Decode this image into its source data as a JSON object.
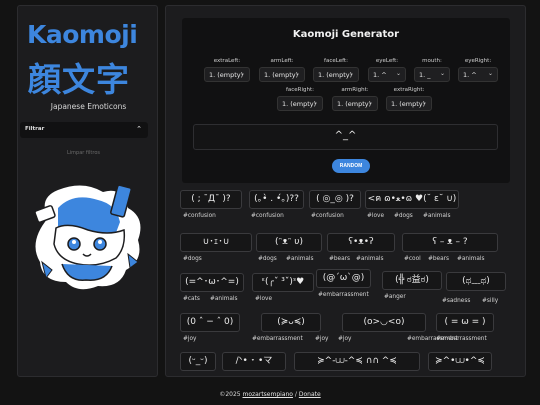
{
  "sidebar": {
    "logo_latin": "Kaomoji",
    "logo_kanji": "顔文字",
    "tagline": "Japanese Emoticons",
    "filter_label": "Filtrar",
    "clear_label": "Limpar filtros"
  },
  "generator": {
    "title": "Kaomoji Generator",
    "selects": [
      {
        "label": "extraLeft:",
        "value": "1. (empty)"
      },
      {
        "label": "armLeft:",
        "value": "1. (empty)"
      },
      {
        "label": "faceLeft:",
        "value": "1. (empty)"
      },
      {
        "label": "eyeLeft:",
        "value": "1. ^"
      },
      {
        "label": "mouth:",
        "value": "1. _"
      },
      {
        "label": "eyeRight:",
        "value": "1. ^"
      },
      {
        "label": "faceRight:",
        "value": "1. (empty)"
      },
      {
        "label": "armRight:",
        "value": "1. (empty)"
      },
      {
        "label": "extraRight:",
        "value": "1. (empty)"
      }
    ],
    "preview": "^_^",
    "random_label": "RANDOM"
  },
  "cards": [
    {
      "text": "( ; ¯Д¯ )?",
      "tags": [
        "#confusion"
      ]
    },
    {
      "text": "(｡•̀ . •́｡)??",
      "tags": [
        "#confusion"
      ]
    },
    {
      "text": "( ◎_◎ )?",
      "tags": [
        "#confusion"
      ]
    },
    {
      "text": "<ฅ ɷ•ﻌ•ɷ ♥(˘ ε˘ ∪)",
      "tags": [
        "#love",
        "#dogs",
        "#animals"
      ]
    },
    {
      "text": "∪･ｪ･∪",
      "tags": [
        "#dogs"
      ]
    },
    {
      "text": "(ᵔᴥᵔ υ)",
      "tags": [
        "#dogs",
        "#animals"
      ]
    },
    {
      "text": "ʕ•ᴥ•ʔ",
      "tags": [
        "#bears",
        "#animals"
      ]
    },
    {
      "text": "ʕ – ᴥ – ?",
      "tags": [
        "#cool",
        "#bears",
        "#animals"
      ]
    },
    {
      "text": "(=^･ω･^=)",
      "tags": [
        "#cats",
        "#animals"
      ]
    },
    {
      "text": "ᵋ(╭ˇ ³ˇ)ᵌ♥",
      "tags": [
        "#love"
      ]
    },
    {
      "text": "(@´ω`@)",
      "tags": [
        "#embarrassment"
      ]
    },
    {
      "text": "(╬ ಠ益ಠ)",
      "tags": [
        "#anger"
      ]
    },
    {
      "text": "(ಥ﹏ಥ)",
      "tags": [
        "#sadness",
        "#silly"
      ]
    },
    {
      "text": "(0 ˆ − ˆ 0)",
      "tags": [
        "#joy"
      ]
    },
    {
      "text": "(≽ᴗ≼)",
      "tags": [
        "#embarrassment",
        "#joy"
      ]
    },
    {
      "text": "(o>◡<o)",
      "tags": [
        "#joy",
        "#embarrassment"
      ]
    },
    {
      "text": "( = ω = )",
      "tags": [
        "#embarrassment"
      ]
    },
    {
      "text": "(ᵕ_ᵕ)",
      "tags": []
    },
    {
      "text": "/ᐠ• ˕ •マ",
      "tags": []
    },
    {
      "text": "≽^-⩊-^≼ ∩∩ ^≼",
      "tags": []
    },
    {
      "text": "≽^•⩊•^≼",
      "tags": []
    }
  ],
  "footer": {
    "copyright": "©2025",
    "author": "mozartsempiano",
    "separator": "/",
    "donate": "Donate"
  },
  "colors": {
    "accent": "#3d86de",
    "background": "#131313",
    "panel": "#1c1c1e"
  }
}
